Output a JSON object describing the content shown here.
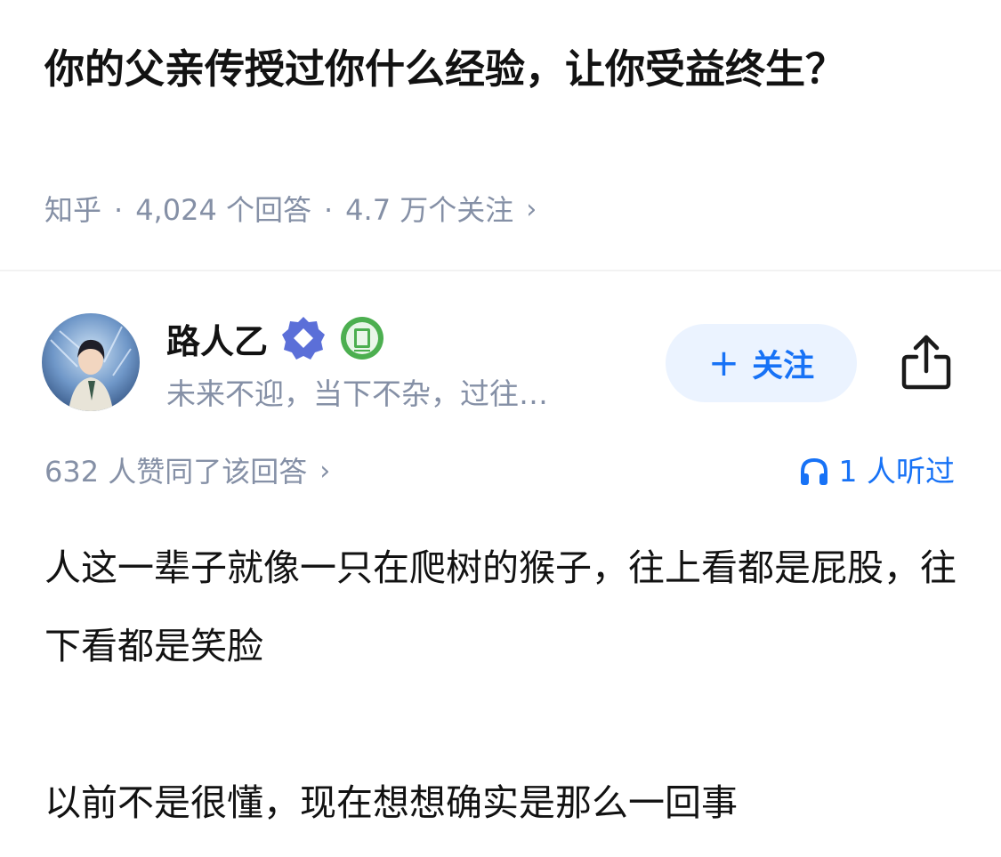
{
  "question": {
    "title": "你的父亲传授过你什么经验，让你受益终生？",
    "source": "知乎",
    "answer_count": "4,024 个回答",
    "follow_count": "4.7 万个关注"
  },
  "author": {
    "name": "路人乙",
    "bio": "未来不迎，当下不杂，过往…",
    "follow_label": "关注",
    "follow_icon": "plus-icon",
    "share_icon": "share-icon"
  },
  "answer": {
    "vote_summary": "632 人赞同了该回答",
    "listen_count": "1 人听过",
    "listen_icon": "headphones-icon",
    "paragraphs": [
      "人这一辈子就像一只在爬树的猴子，往上看都是屁股，往下看都是笑脸",
      "以前不是很懂，现在想想确实是那么一回事"
    ]
  },
  "colors": {
    "accent": "#1772f6",
    "follow_bg": "#ebf3ff",
    "meta_gray": "#8590a6",
    "title_black": "#121212",
    "badge_blue": "#5b6fd8",
    "badge_green": "#4caf50"
  }
}
